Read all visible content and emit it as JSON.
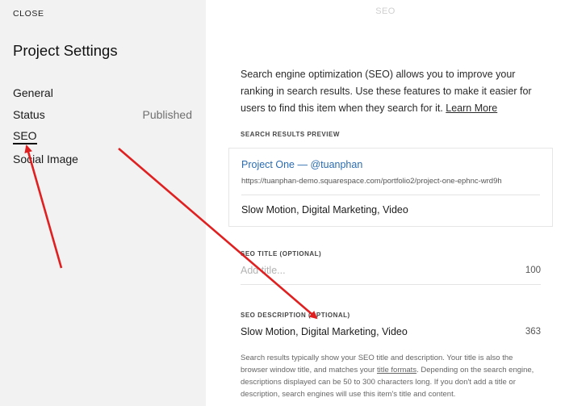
{
  "sidebar": {
    "close_label": "CLOSE",
    "title": "Project Settings",
    "items": [
      {
        "label": "General",
        "value": ""
      },
      {
        "label": "Status",
        "value": "Published"
      },
      {
        "label": "SEO",
        "value": "",
        "active": true
      },
      {
        "label": "Social Image",
        "value": ""
      }
    ]
  },
  "panel": {
    "header": "SEO",
    "intro_text": "Search engine optimization (SEO) allows you to improve your ranking in search results. Use these features to make it easier for users to find this item when they search for it. ",
    "learn_more": "Learn More",
    "preview": {
      "label": "SEARCH RESULTS PREVIEW",
      "title": "Project One — @tuanphan",
      "url": "https://tuanphan-demo.squarespace.com/portfolio2/project-one-ephnc-wrd9h",
      "description": "Slow Motion, Digital Marketing, Video"
    },
    "seo_title": {
      "label": "SEO TITLE (OPTIONAL)",
      "placeholder": "Add title...",
      "count": "100"
    },
    "seo_description": {
      "label": "SEO DESCRIPTION (OPTIONAL)",
      "value": "Slow Motion, Digital Marketing, Video",
      "count": "363"
    },
    "help": {
      "text_before": "Search results typically show your SEO title and description. Your title is also the browser window title, and matches your ",
      "link": "title formats",
      "text_after": ". Depending on the search engine, descriptions displayed can be 50 to 300 characters long. If you don't add a title or description, search engines will use this item's title and content."
    }
  },
  "colors": {
    "annotation_arrow": "#e02020",
    "link_blue": "#2b6cb0",
    "sidebar_bg": "#f2f2f2",
    "panel_bg": "#ffffff"
  }
}
